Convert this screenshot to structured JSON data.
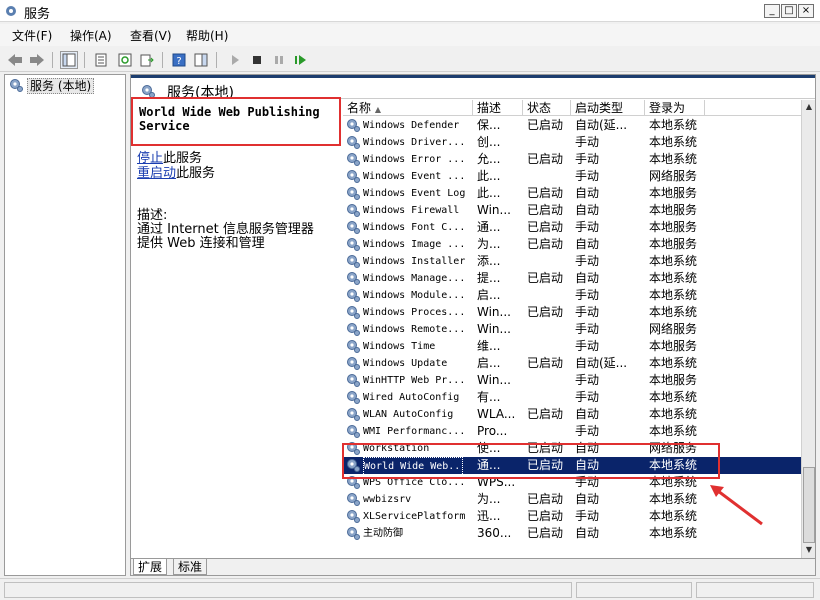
{
  "window": {
    "title": "服务",
    "min_glyph": "_",
    "max_glyph": "□",
    "close_glyph": "×"
  },
  "menu": [
    "文件(F)",
    "操作(A)",
    "查看(V)",
    "帮助(H)"
  ],
  "tree": {
    "root_label": "服务 (本地)"
  },
  "panel": {
    "title": "服务(本地)"
  },
  "detail": {
    "service_name": "World Wide Web Publishing Service",
    "stop_link_u": "停止",
    "stop_link_rest": "此服务",
    "restart_link_u": "重启动",
    "restart_link_rest": "此服务",
    "desc_label": "描述:",
    "desc_text": "通过 Internet 信息服务管理器\n提供 Web 连接和管理"
  },
  "columns": {
    "name": "名称",
    "desc": "描述",
    "status": "状态",
    "startup": "启动类型",
    "logon": "登录为"
  },
  "rows": [
    {
      "name": "Windows Defender",
      "desc": "保...",
      "status": "已启动",
      "startup": "自动(延...",
      "logon": "本地系统"
    },
    {
      "name": "Windows Driver...",
      "desc": "创...",
      "status": "",
      "startup": "手动",
      "logon": "本地系统"
    },
    {
      "name": "Windows Error ...",
      "desc": "允...",
      "status": "已启动",
      "startup": "手动",
      "logon": "本地系统"
    },
    {
      "name": "Windows Event ...",
      "desc": "此...",
      "status": "",
      "startup": "手动",
      "logon": "网络服务"
    },
    {
      "name": "Windows Event Log",
      "desc": "此...",
      "status": "已启动",
      "startup": "自动",
      "logon": "本地服务"
    },
    {
      "name": "Windows Firewall",
      "desc": "Win...",
      "status": "已启动",
      "startup": "自动",
      "logon": "本地服务"
    },
    {
      "name": "Windows Font C...",
      "desc": "通...",
      "status": "已启动",
      "startup": "手动",
      "logon": "本地服务"
    },
    {
      "name": "Windows Image ...",
      "desc": "为...",
      "status": "已启动",
      "startup": "自动",
      "logon": "本地服务"
    },
    {
      "name": "Windows Installer",
      "desc": "添...",
      "status": "",
      "startup": "手动",
      "logon": "本地系统"
    },
    {
      "name": "Windows Manage...",
      "desc": "提...",
      "status": "已启动",
      "startup": "自动",
      "logon": "本地系统"
    },
    {
      "name": "Windows Module...",
      "desc": "启...",
      "status": "",
      "startup": "手动",
      "logon": "本地系统"
    },
    {
      "name": "Windows Proces...",
      "desc": "Win...",
      "status": "已启动",
      "startup": "手动",
      "logon": "本地系统"
    },
    {
      "name": "Windows Remote...",
      "desc": "Win...",
      "status": "",
      "startup": "手动",
      "logon": "网络服务"
    },
    {
      "name": "Windows Time",
      "desc": "维...",
      "status": "",
      "startup": "手动",
      "logon": "本地服务"
    },
    {
      "name": "Windows Update",
      "desc": "启...",
      "status": "已启动",
      "startup": "自动(延...",
      "logon": "本地系统"
    },
    {
      "name": "WinHTTP Web Pr...",
      "desc": "Win...",
      "status": "",
      "startup": "手动",
      "logon": "本地服务"
    },
    {
      "name": "Wired AutoConfig",
      "desc": "有...",
      "status": "",
      "startup": "手动",
      "logon": "本地系统"
    },
    {
      "name": "WLAN AutoConfig",
      "desc": "WLA...",
      "status": "已启动",
      "startup": "自动",
      "logon": "本地系统"
    },
    {
      "name": "WMI Performanc...",
      "desc": "Pro...",
      "status": "",
      "startup": "手动",
      "logon": "本地系统"
    },
    {
      "name": "Workstation",
      "desc": "使...",
      "status": "已启动",
      "startup": "自动",
      "logon": "网络服务"
    },
    {
      "name": "World Wide Web...",
      "desc": "通...",
      "status": "已启动",
      "startup": "自动",
      "logon": "本地系统",
      "selected": true
    },
    {
      "name": "WPS Office Clo...",
      "desc": "WPS...",
      "status": "",
      "startup": "手动",
      "logon": "本地系统"
    },
    {
      "name": "wwbizsrv",
      "desc": "为...",
      "status": "已启动",
      "startup": "自动",
      "logon": "本地系统"
    },
    {
      "name": "XLServicePlatform",
      "desc": "迅...",
      "status": "已启动",
      "startup": "手动",
      "logon": "本地系统"
    },
    {
      "name": "主动防御",
      "desc": "360...",
      "status": "已启动",
      "startup": "自动",
      "logon": "本地系统"
    }
  ],
  "tabs": [
    "扩展",
    "标准"
  ],
  "colors": {
    "accent": "#0a246a",
    "highlight_box": "#e03030",
    "link": "#1a3db0"
  }
}
